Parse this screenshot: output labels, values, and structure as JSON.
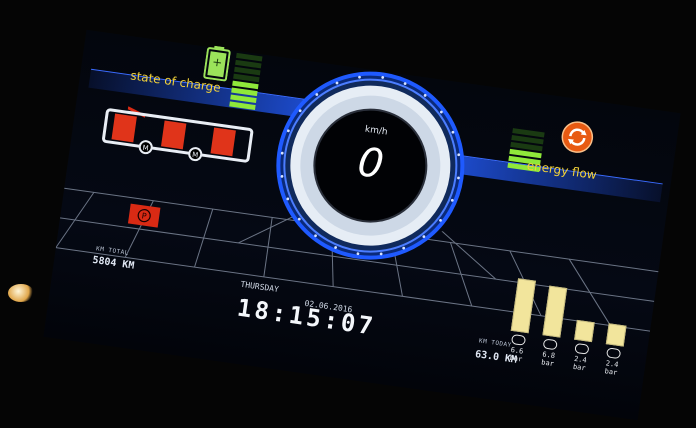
{
  "cluster": {
    "state_of_charge_label": "state of charge",
    "energy_flow_label": "energy flow",
    "state_of_charge_level": 0.5,
    "energy_flow_level": 0.5
  },
  "speed": {
    "value": "0",
    "unit": "km/h"
  },
  "odometer": {
    "total_label": "KM TOTAL",
    "total_value": "5804 KM",
    "today_label": "KM TODAY",
    "today_value": "63.0 KM"
  },
  "clock": {
    "weekday": "THURSDAY",
    "date": "02.06.2016",
    "time": "18:15:07"
  },
  "pressure": {
    "unit": "bar",
    "circuits": [
      {
        "value": "6.6",
        "level": 0.85
      },
      {
        "value": "6.8",
        "level": 0.8
      },
      {
        "value": "2.4",
        "level": 0.3
      },
      {
        "value": "2.4",
        "level": 0.32
      }
    ]
  },
  "colors": {
    "accent_blue": "#1e4fd8",
    "charge_green": "#8fe83a",
    "label_yellow": "#f2d23a",
    "warning_red": "#d92a14",
    "pressure_bar": "#f2e59c"
  }
}
